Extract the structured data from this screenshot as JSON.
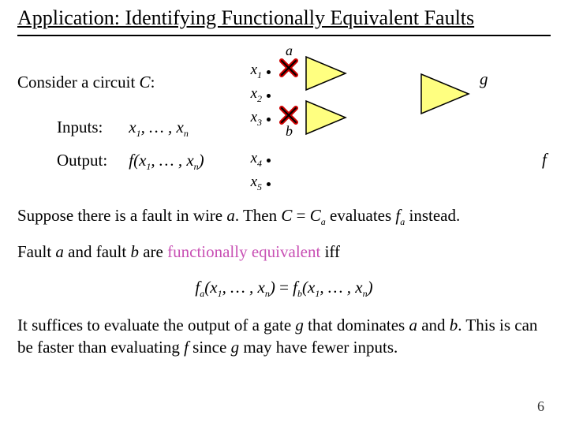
{
  "title": {
    "prefix": "Application:",
    "rest": " Identifying Functionally Equivalent Faults"
  },
  "consider": {
    "pre": "Consider a circuit  ",
    "sym": "C",
    "post": ":"
  },
  "defs": {
    "inputs_label": "Inputs:",
    "inputs_value_pre": "x",
    "inputs_value_mid": ", … , x",
    "output_label": "Output:",
    "output_value_pre": "f(x",
    "output_value_mid": ", … , x",
    "output_value_post": ")"
  },
  "diagram": {
    "x1": "x",
    "x2": "x",
    "x3": "x",
    "x4": "x",
    "x5": "x",
    "s1": "1",
    "s2": "2",
    "s3": "3",
    "s4": "4",
    "s5": "5",
    "a": "a",
    "b": "b",
    "g": "g",
    "f": "f"
  },
  "para1": {
    "t1": "Suppose there is a fault in wire  ",
    "a": "a",
    "t2": ".  Then  ",
    "C": "C",
    "eq": " = ",
    "Ca": "C",
    "sa": "a",
    "t3": "  evaluates  ",
    "fa": "f",
    "t4": "  instead."
  },
  "para2": {
    "t1": "Fault  ",
    "a": "a",
    "t2": "  and  fault  ",
    "b": "b",
    "t3": "  are  ",
    "fe": "functionally equivalent",
    "t4": "  iff"
  },
  "eq": {
    "lhs_f": "f",
    "lhs_sub": "a",
    "lhs_args_pre": "(x",
    "lhs_args_mid": ", … , x",
    "lhs_args_post": ")",
    "mid": "   =   ",
    "rhs_f": "f",
    "rhs_sub": "b"
  },
  "para3": {
    "t1": "It suffices to evaluate the output of a gate  ",
    "g": "g",
    "t2": "  that dominates  ",
    "a": "a",
    "t3": "  and  ",
    "b": "b",
    "t4": ". This is can be faster than evaluating  ",
    "f": "f",
    "t5": "  since  ",
    "g2": "g",
    "t6": "  may have fewer inputs."
  },
  "subs": {
    "one": "1",
    "n": "n"
  },
  "page": "6"
}
